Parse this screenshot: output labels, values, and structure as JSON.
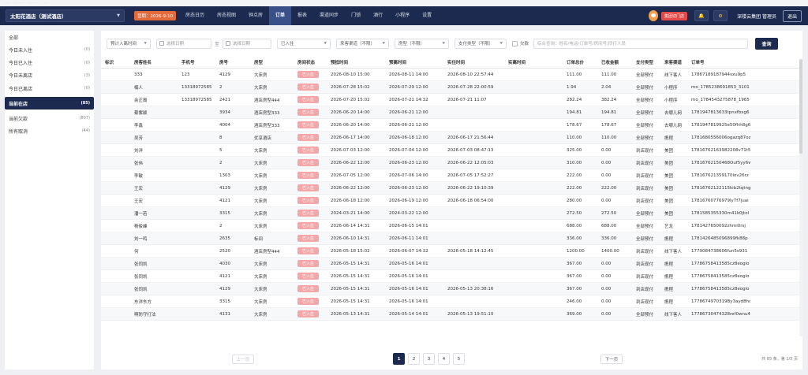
{
  "topstrip": [
    "·  ·  ·",
    "· · · · ·",
    "· · · · ·",
    "· · ·"
  ],
  "header": {
    "hotel": "太阳花酒店（测试酒店）",
    "business_date": "营期：2026-9-10",
    "nav": [
      "房态日历",
      "房态视图",
      "钟点房",
      "订单",
      "报表",
      "渠道同步",
      "门锁",
      "酒行",
      "小程序",
      "设置"
    ],
    "active_nav": "订单",
    "group_button": "集团切门店",
    "user": "深楼云集团 管理员",
    "logout": "退出"
  },
  "sidebar": {
    "items": [
      {
        "label": "全部",
        "count": ""
      },
      {
        "label": "今日未入住",
        "count": "(0)"
      },
      {
        "label": "今日已入住",
        "count": "(0)"
      },
      {
        "label": "今日未离店",
        "count": "(3)"
      },
      {
        "label": "今日已离店",
        "count": "(0)"
      },
      {
        "label": "当前在店",
        "count": "(85)",
        "active": true
      },
      {
        "label": "当前欠款",
        "count": "(807)"
      },
      {
        "label": "所有取消",
        "count": "(44)"
      }
    ]
  },
  "filters": {
    "time_type": "预计入离时间",
    "start_placeholder": "选择日期",
    "range_sep": "至",
    "end_placeholder": "选择日期",
    "status": "已入住",
    "channel": "来客渠道（不限）",
    "room_type": "房型（不限）",
    "pay_type": "支付类型（不限）",
    "arrears_label": "欠款",
    "search_placeholder": "综合查询：姓名/电话/订单号/房间号/同行人员",
    "query_button": "查询"
  },
  "table": {
    "columns": [
      "标识",
      "房客姓名",
      "手机号",
      "房号",
      "房型",
      "房间状态",
      "预抵时间",
      "预离时间",
      "实住时间",
      "实离时间",
      "订单总价",
      "已收金额",
      "支付类型",
      "来客渠道",
      "订单号"
    ],
    "rows": [
      [
        "",
        "333",
        "123",
        "4129",
        "大床房",
        "已入住",
        "2026-08-10 15:00",
        "2026-08-11 14:00",
        "2026-08-10 22:57:44",
        "",
        "111.00",
        "111.00",
        "全部预付",
        "线下客人",
        "17867189187944vzu9p5"
      ],
      [
        "",
        "楠人",
        "13318972585",
        "2",
        "大床房",
        "已入住",
        "2026-07-28 15:02",
        "2026-07-29 12:00",
        "2026-07-28 22:00:59",
        "",
        "1.94",
        "2.04",
        "全部预付",
        "小程序",
        "mo_1785238691853_3101"
      ],
      [
        "",
        "余正裔",
        "13318972585",
        "2421",
        "酒店房型444",
        "已入住",
        "2026-07-20 15:02",
        "2026-07-21 14:32",
        "2026-07-21 11:07",
        "",
        "282.24",
        "382.24",
        "全部预付",
        "小程序",
        "mo_1784543275878_1965"
      ],
      [
        "",
        "蔡紫颖",
        "",
        "3934",
        "酒店房型333",
        "已入住",
        "2026-06-20 14:00",
        "2026-06-21 12:00",
        "",
        "",
        "194.81",
        "194.81",
        "全部预付",
        "去哪儿网",
        "1781947813633tpnxfbxg6"
      ],
      [
        "",
        "李鑫",
        "",
        "4004",
        "酒店房型333",
        "已入住",
        "2026-06-20 14:00",
        "2026-06-21 12:00",
        "",
        "",
        "178.67",
        "178.67",
        "全部预付",
        "去哪儿网",
        "1781947819925e50fhh8g6"
      ],
      [
        "",
        "吴芳",
        "",
        "8",
        "优享酒店",
        "已入住",
        "2026-06-17 14:00",
        "2026-06-18 12:00",
        "2026-06-17 21:56:44",
        "",
        "110.00",
        "110.00",
        "全部预付",
        "携程",
        "1781680556006ogazq87oz"
      ],
      [
        "",
        "刘洋",
        "",
        "5",
        "大床房",
        "已入住",
        "2026-07-03 12:00",
        "2026-07-04 12:00",
        "2026-07-03 08:47:13",
        "",
        "325.00",
        "0.00",
        "到店现付",
        "美团",
        "17816762163982208v71t5"
      ],
      [
        "",
        "张伟",
        "",
        "2",
        "大床房",
        "已入住",
        "2026-06-22 12:00",
        "2026-06-23 12:00",
        "2026-06-22 12:05:03",
        "",
        "310.00",
        "0.00",
        "到店现付",
        "美团",
        "17816762150468Ouf5yy6w"
      ],
      [
        "",
        "李敏",
        "",
        "1303",
        "大床房",
        "已入住",
        "2026-07-05 12:00",
        "2026-07-06 14:00",
        "2026-07-05 17:52:27",
        "",
        "222.00",
        "0.00",
        "到店现付",
        "美团",
        "178167621359170lov26rz"
      ],
      [
        "",
        "王宏",
        "",
        "4129",
        "大床房",
        "已入住",
        "2026-06-22 12:00",
        "2026-06-23 12:00",
        "2026-06-22 19:10:39",
        "",
        "222.00",
        "222.00",
        "到店现付",
        "美团",
        "17816762122115kib2tqtng"
      ],
      [
        "",
        "王宏",
        "",
        "4121",
        "大床房",
        "已入住",
        "2026-06-18 12:00",
        "2026-06-19 12:00",
        "2026-06-18 06:54:00",
        "",
        "280.00",
        "0.00",
        "到店现付",
        "美团",
        "17816760776979ly7f7juai"
      ],
      [
        "",
        "潘一若",
        "",
        "3315",
        "大床房",
        "已入住",
        "2024-03-21 14:00",
        "2024-03-22 12:00",
        "",
        "",
        "272.50",
        "272.50",
        "全部预付",
        "美团",
        "1781585355330m41k0jtol"
      ],
      [
        "",
        "杨俊峰",
        "",
        "2",
        "大床房",
        "已入住",
        "2026-06-14 14:31",
        "2026-06-15 14:01",
        "",
        "",
        "688.00",
        "688.00",
        "全部预付",
        "艺龙",
        "1781427650092zhmi0rsj"
      ],
      [
        "",
        "刘一鸣",
        "",
        "2635",
        "标间",
        "已入住",
        "2026-06-10 14:31",
        "2026-06-11 14:01",
        "",
        "",
        "336.00",
        "336.00",
        "全部预付",
        "携程",
        "1781426485096899fk88p"
      ],
      [
        "",
        "何",
        "",
        "2520",
        "酒店房型444",
        "已入住",
        "2026-05-18 15:02",
        "2026-06-07 14:32",
        "2026-05-18 14:12:45",
        "",
        "1200.00",
        "1400.00",
        "到店现付",
        "线下客人",
        "1779084738606fun5s931"
      ],
      [
        "",
        "张同凯",
        "",
        "4030",
        "大床房",
        "已入住",
        "2026-05-15 14:31",
        "2026-05-16 14:01",
        "",
        "",
        "367.00",
        "0.00",
        "到店现付",
        "携程",
        "17786758413585cz8eoglo"
      ],
      [
        "",
        "张同凯",
        "",
        "4121",
        "大床房",
        "已入住",
        "2026-05-15 14:31",
        "2026-05-16 14:01",
        "",
        "",
        "367.00",
        "0.00",
        "到店现付",
        "携程",
        "17786758413585cz8eoglo"
      ],
      [
        "",
        "张同凯",
        "",
        "4129",
        "大床房",
        "已入住",
        "2026-05-15 14:31",
        "2026-05-16 14:01",
        "2026-05-13 20:38:16",
        "",
        "367.00",
        "0.00",
        "到店现付",
        "携程",
        "17786758413585cz8eoglo"
      ],
      [
        "",
        "东洋东方",
        "",
        "3315",
        "大床房",
        "已入住",
        "2026-05-15 14:31",
        "2026-05-16 14:01",
        "",
        "",
        "246.00",
        "0.00",
        "到店现付",
        "携程",
        "1778674970319By3ayd8hq"
      ],
      [
        "",
        "啊防守打法",
        "",
        "4131",
        "大床房",
        "已入住",
        "2026-05-13 14:31",
        "2026-05-14 14:01",
        "2026-05-13 19:51:10",
        "",
        "369.00",
        "0.00",
        "全部预付",
        "线下客人",
        "17786730474328ref0wnu48"
      ]
    ]
  },
  "pager": {
    "prev": "上一页",
    "pages": [
      "1",
      "2",
      "3",
      "4",
      "5"
    ],
    "active_page": "1",
    "next": "下一页",
    "total": "共 85 条，第 1/5 页"
  }
}
